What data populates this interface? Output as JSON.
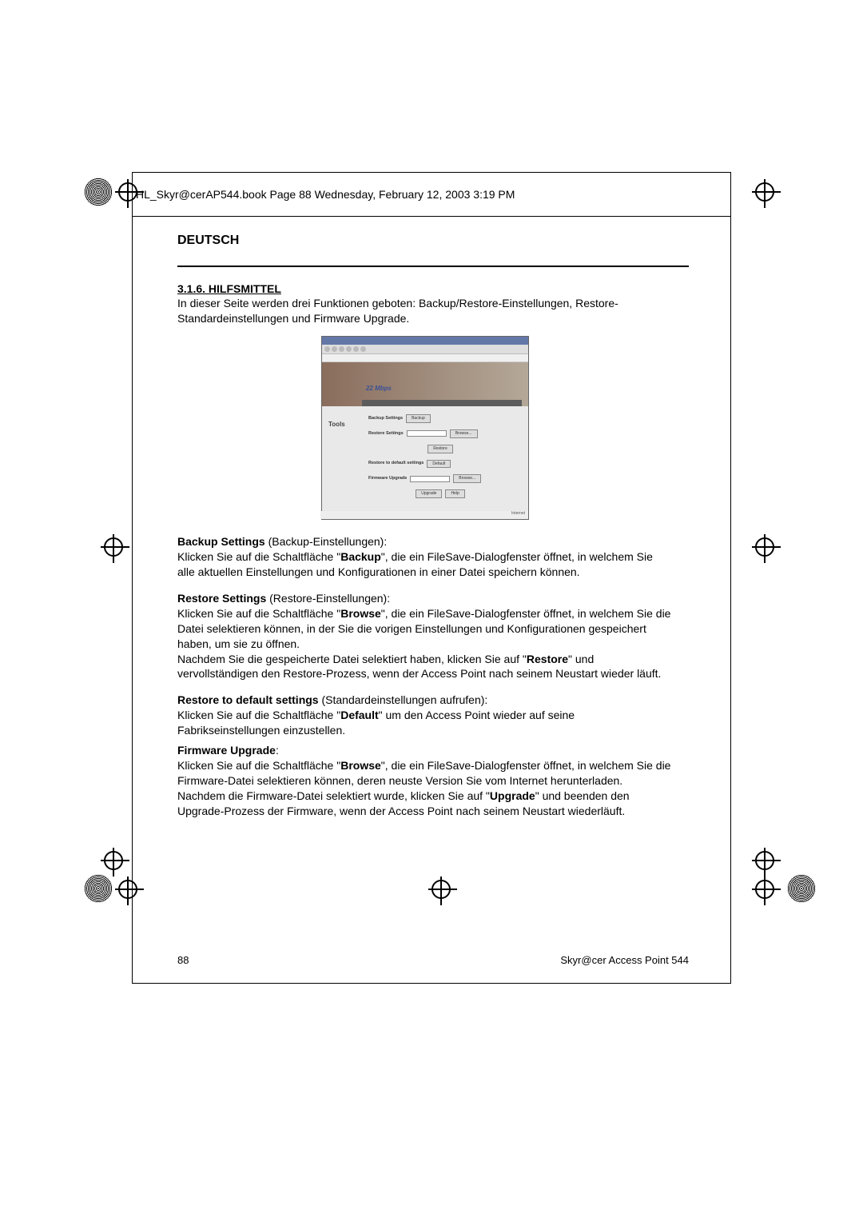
{
  "header_line": "HL_Skyr@cerAP544.book  Page 88  Wednesday, February 12, 2003  3:19 PM",
  "language": "DEUTSCH",
  "section_heading": "3.1.6. HILFSMITTEL",
  "intro": "In dieser Seite werden drei Funktionen geboten: Backup/Restore-Einstellungen, Restore-Standardeinstellungen und Firmware Upgrade.",
  "screenshot": {
    "banner_text": "22 Mbps",
    "side_label": "Tools",
    "rows": {
      "backup_label": "Backup Settings",
      "backup_btn": "Backup",
      "restore_label": "Restore Settings",
      "browse_btn": "Browse...",
      "restore_btn": "Restore",
      "default_label": "Restore to default settings",
      "default_btn": "Default",
      "firmware_label": "Firmware Upgrade",
      "upgrade_btn": "Upgrade",
      "help_btn": "Help"
    },
    "footer_text": "Internet"
  },
  "backup": {
    "title": "Backup Settings",
    "suffix": " (Backup-Einstellungen):",
    "p1a": "Klicken Sie auf die Schaltfläche \"",
    "p1b": "Backup",
    "p1c": "\", die ein FileSave-Dialogfenster öffnet, in welchem Sie alle aktuellen Einstellungen und Konfigurationen in einer Datei speichern können."
  },
  "restore": {
    "title": "Restore Settings",
    "suffix": " (Restore-Einstellungen):",
    "p1a": "Klicken Sie auf die Schaltfläche \"",
    "p1b": "Browse",
    "p1c": "\", die ein FileSave-Dialogfenster öffnet, in welchem Sie die Datei selektieren können, in der Sie die vorigen Einstellungen und Konfigurationen gespeichert haben, um sie zu öffnen.",
    "p2a": "Nachdem Sie die gespeicherte Datei selektiert haben, klicken Sie auf \"",
    "p2b": "Restore",
    "p2c": "\" und vervollständigen den Restore-Prozess, wenn der Access Point nach seinem Neustart wieder läuft."
  },
  "defaults": {
    "title": "Restore to default settings",
    "suffix": " (Standardeinstellungen aufrufen):",
    "p1a": "Klicken Sie auf die Schaltfläche \"",
    "p1b": "Default",
    "p1c": "\" um den Access Point wieder auf seine Fabrikseinstellungen einzustellen."
  },
  "firmware": {
    "title": "Firmware Upgrade",
    "suffix": ":",
    "p1a": "Klicken Sie auf die Schaltfläche \"",
    "p1b": "Browse",
    "p1c": "\", die ein FileSave-Dialogfenster öffnet, in welchem Sie die Firmware-Datei selektieren können, deren neuste Version Sie vom Internet herunterladen.",
    "p2a": "Nachdem die Firmware-Datei selektiert wurde, klicken Sie auf \"",
    "p2b": "Upgrade",
    "p2c": "\" und beenden den Upgrade-Prozess der Firmware, wenn der Access Point nach seinem Neustart wiederläuft."
  },
  "footer": {
    "page_number": "88",
    "product": "Skyr@cer Access Point 544"
  }
}
